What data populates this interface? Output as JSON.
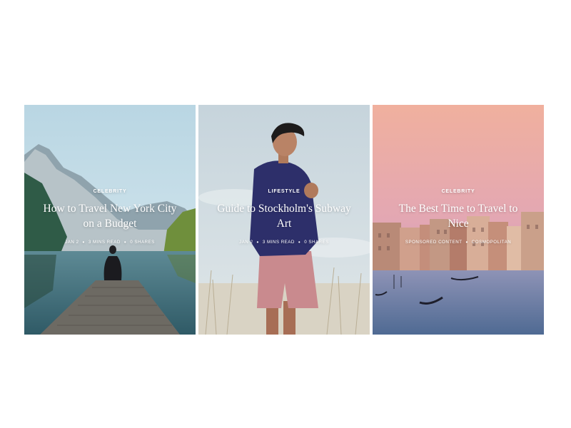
{
  "cards": [
    {
      "category": "Celebrity",
      "title": "How to Travel New York City on a Budget",
      "date": "Jan 2",
      "read_time": "3 Mins Read",
      "shares": "0 Shares",
      "image": "mountain-lake-pier-photo"
    },
    {
      "category": "Lifestyle",
      "title": "Guide to Stockholm's Subway Art",
      "date": "Jan 2",
      "read_time": "3 Mins Read",
      "shares": "0 Shares",
      "image": "young-man-in-field-photo"
    },
    {
      "category": "Celebrity",
      "title": "The Best Time to Travel to Nice",
      "sponsor": "Sponsored Content",
      "publisher": "Cosmopolitan",
      "image": "venice-canal-sunset-photo"
    }
  ]
}
